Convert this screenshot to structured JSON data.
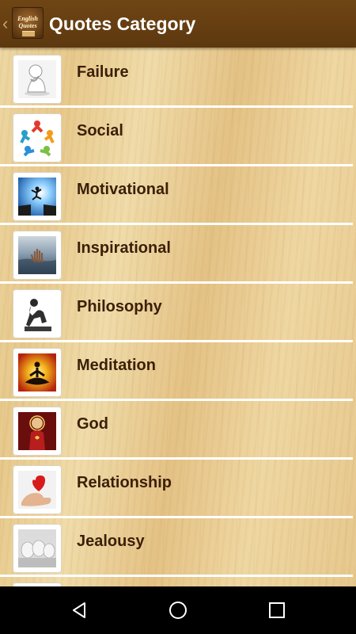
{
  "action_bar": {
    "title": "Quotes Category",
    "app_logo_lines": [
      "English",
      "Quotes"
    ],
    "background_color": "#6b4213"
  },
  "categories": [
    {
      "label": "Failure",
      "icon": "sad-figure-icon"
    },
    {
      "label": "Social",
      "icon": "people-circle-icon"
    },
    {
      "label": "Motivational",
      "icon": "jumping-man-icon"
    },
    {
      "label": "Inspirational",
      "icon": "hand-in-water-icon"
    },
    {
      "label": "Philosophy",
      "icon": "thinker-statue-icon"
    },
    {
      "label": "Meditation",
      "icon": "meditation-icon"
    },
    {
      "label": "God",
      "icon": "sacred-heart-icon"
    },
    {
      "label": "Relationship",
      "icon": "heart-in-hand-icon"
    },
    {
      "label": "Jealousy",
      "icon": "eggs-icon"
    }
  ],
  "colors": {
    "label_text": "#3b1f08",
    "divider": "#ffffff",
    "title_text": "#ffffff"
  },
  "nav_bar": {
    "buttons": [
      "back",
      "home",
      "recent-apps"
    ]
  }
}
